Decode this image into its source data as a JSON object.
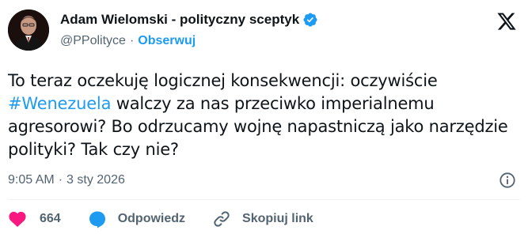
{
  "author": {
    "display_name": "Adam Wielomski - polityczny sceptyk",
    "handle": "@PPolityce",
    "separator": "·",
    "follow_label": "Obserwuj"
  },
  "tweet": {
    "text_before": "To teraz oczekuję logicznej konsekwencji: oczywiście ",
    "hashtag": "#Wenezuela",
    "text_after": " walczy za nas przeciwko imperialnemu agresorowi? Bo odrzucamy wojnę napastniczą jako narzędzie polityki? Tak czy nie?",
    "time": "9:05 AM",
    "separator": "·",
    "date": "3 sty 2026"
  },
  "actions": {
    "like_count": "664",
    "reply_label": "Odpowiedz",
    "copy_link_label": "Skopiuj link"
  },
  "icons": {
    "verified": "verified-badge-icon",
    "x_logo": "x-logo-icon",
    "info": "info-icon",
    "like": "heart-icon",
    "reply": "speech-bubble-icon",
    "link": "link-icon"
  },
  "colors": {
    "accent": "#1d9bf0",
    "like": "#f91880",
    "text": "#0f1419",
    "muted": "#536471"
  }
}
